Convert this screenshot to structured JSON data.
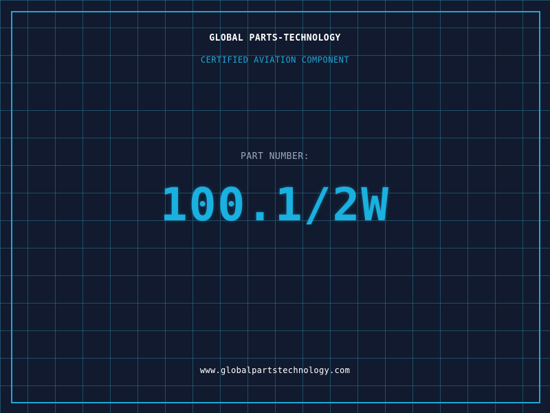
{
  "header": {
    "company": "GLOBAL PARTS-TECHNOLOGY",
    "tagline": "CERTIFIED AVIATION COMPONENT"
  },
  "main": {
    "label": "PART NUMBER:",
    "part_number": "100.1/2W"
  },
  "footer": {
    "website": "www.globalpartstechnology.com"
  },
  "colors": {
    "background": "#111a2e",
    "grid": "#287896",
    "accent": "#1ea8d8",
    "text": "#ffffff",
    "label": "#9aa8bf"
  }
}
